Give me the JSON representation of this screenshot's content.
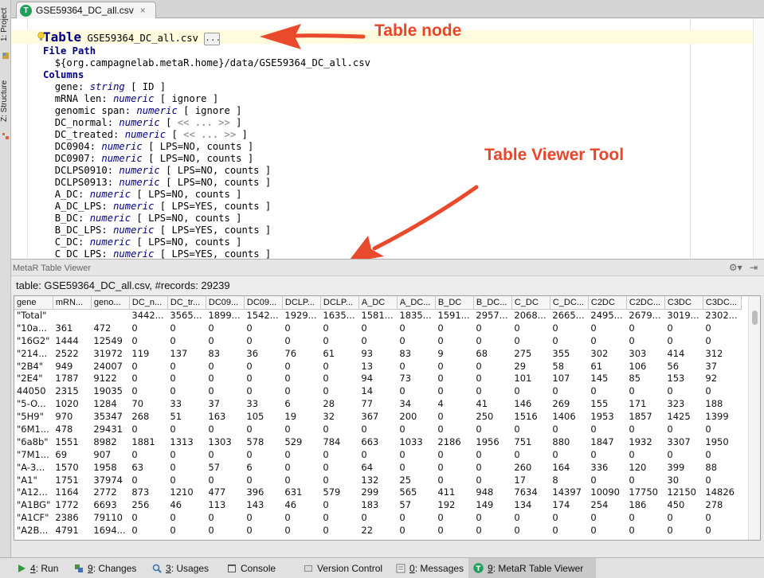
{
  "side_tabs": {
    "project": "1: Project",
    "structure": "Z: Structure"
  },
  "editor_tab": {
    "label": "GSE59364_DC_all.csv",
    "badge": "T",
    "close": "×"
  },
  "code": {
    "table_kw": "Table",
    "table_name": "GSE59364_DC_all.csv",
    "dots": "...",
    "file_path_kw": "File Path",
    "file_path": "${org.campagnelab.metaR.home}/data/GSE59364_DC_all.csv",
    "columns_kw": "Columns",
    "columns": [
      {
        "name": "gene:",
        "type": "string",
        "pre": " [ ",
        "meta": "ID",
        "post": " ]",
        "gray": false
      },
      {
        "name": "mRNA len:",
        "type": "numeric",
        "pre": " [ ",
        "meta": "ignore",
        "post": " ]",
        "gray": false
      },
      {
        "name": "genomic span:",
        "type": "numeric",
        "pre": " [ ",
        "meta": "ignore",
        "post": " ]",
        "gray": false
      },
      {
        "name": "DC_normal:",
        "type": "numeric",
        "pre": " [ ",
        "meta": "<< ... >>",
        "post": " ]",
        "gray": true
      },
      {
        "name": "DC_treated:",
        "type": "numeric",
        "pre": " [ ",
        "meta": "<< ... >>",
        "post": " ]",
        "gray": true
      },
      {
        "name": "DC0904:",
        "type": "numeric",
        "pre": " [ ",
        "meta": "LPS=NO, counts",
        "post": " ]",
        "gray": false
      },
      {
        "name": "DC0907:",
        "type": "numeric",
        "pre": " [ ",
        "meta": "LPS=NO, counts",
        "post": " ]",
        "gray": false
      },
      {
        "name": "DCLPS0910:",
        "type": "numeric",
        "pre": " [ ",
        "meta": "LPS=NO, counts",
        "post": " ]",
        "gray": false
      },
      {
        "name": "DCLPS0913:",
        "type": "numeric",
        "pre": " [ ",
        "meta": "LPS=NO, counts",
        "post": " ]",
        "gray": false
      },
      {
        "name": "A_DC:",
        "type": "numeric",
        "pre": " [ ",
        "meta": "LPS=NO, counts",
        "post": " ]",
        "gray": false
      },
      {
        "name": "A_DC_LPS:",
        "type": "numeric",
        "pre": " [ ",
        "meta": "LPS=YES, counts",
        "post": " ]",
        "gray": false
      },
      {
        "name": "B_DC:",
        "type": "numeric",
        "pre": " [ ",
        "meta": "LPS=NO, counts",
        "post": " ]",
        "gray": false
      },
      {
        "name": "B_DC_LPS:",
        "type": "numeric",
        "pre": " [ ",
        "meta": "LPS=YES, counts",
        "post": " ]",
        "gray": false
      },
      {
        "name": "C_DC:",
        "type": "numeric",
        "pre": " [ ",
        "meta": "LPS=NO, counts",
        "post": " ]",
        "gray": false
      },
      {
        "name": "C_DC_LPS:",
        "type": "numeric",
        "pre": " [ ",
        "meta": "LPS=YES, counts",
        "post": " ]",
        "gray": false
      }
    ]
  },
  "annotations": {
    "table_node": "Table node",
    "viewer_tool": "Table Viewer Tool",
    "color": "#e8452a"
  },
  "viewer": {
    "title": "MetaR Table Viewer",
    "info": "table: GSE59364_DC_all.csv, #records: 29239",
    "headers": [
      "gene",
      "mRN...",
      "geno...",
      "DC_n...",
      "DC_tr...",
      "DC09...",
      "DC09...",
      "DCLP...",
      "DCLP...",
      "A_DC",
      "A_DC...",
      "B_DC",
      "B_DC...",
      "C_DC",
      "C_DC...",
      "C2DC",
      "C2DC...",
      "C3DC",
      "C3DC..."
    ],
    "rows": [
      [
        "\"Total\"",
        "",
        "",
        "3442...",
        "3565...",
        "1899...",
        "1542...",
        "1929...",
        "1635...",
        "1581...",
        "1835...",
        "1591...",
        "2957...",
        "2068...",
        "2665...",
        "2495...",
        "2679...",
        "3019...",
        "2302..."
      ],
      [
        "\"10a...",
        "361",
        "472",
        "0",
        "0",
        "0",
        "0",
        "0",
        "0",
        "0",
        "0",
        "0",
        "0",
        "0",
        "0",
        "0",
        "0",
        "0",
        "0"
      ],
      [
        "\"16G2\"",
        "1444",
        "12549",
        "0",
        "0",
        "0",
        "0",
        "0",
        "0",
        "0",
        "0",
        "0",
        "0",
        "0",
        "0",
        "0",
        "0",
        "0",
        "0"
      ],
      [
        "\"214...",
        "2522",
        "31972",
        "119",
        "137",
        "83",
        "36",
        "76",
        "61",
        "93",
        "83",
        "9",
        "68",
        "275",
        "355",
        "302",
        "303",
        "414",
        "312"
      ],
      [
        "\"2B4\"",
        "949",
        "24007",
        "0",
        "0",
        "0",
        "0",
        "0",
        "0",
        "13",
        "0",
        "0",
        "0",
        "29",
        "58",
        "61",
        "106",
        "56",
        "37"
      ],
      [
        "\"2E4\"",
        "1787",
        "9122",
        "0",
        "0",
        "0",
        "0",
        "0",
        "0",
        "94",
        "73",
        "0",
        "0",
        "101",
        "107",
        "145",
        "85",
        "153",
        "92"
      ],
      [
        "44050",
        "2315",
        "19035",
        "0",
        "0",
        "0",
        "0",
        "0",
        "0",
        "14",
        "0",
        "0",
        "0",
        "0",
        "0",
        "0",
        "0",
        "0",
        "0"
      ],
      [
        "\"5-O...",
        "1020",
        "1284",
        "70",
        "33",
        "37",
        "33",
        "6",
        "28",
        "77",
        "34",
        "4",
        "41",
        "146",
        "269",
        "155",
        "171",
        "323",
        "188"
      ],
      [
        "\"5H9\"",
        "970",
        "35347",
        "268",
        "51",
        "163",
        "105",
        "19",
        "32",
        "367",
        "200",
        "0",
        "250",
        "1516",
        "1406",
        "1953",
        "1857",
        "1425",
        "1399"
      ],
      [
        "\"6M1...",
        "478",
        "29431",
        "0",
        "0",
        "0",
        "0",
        "0",
        "0",
        "0",
        "0",
        "0",
        "0",
        "0",
        "0",
        "0",
        "0",
        "0",
        "0"
      ],
      [
        "\"6a8b\"",
        "1551",
        "8982",
        "1881",
        "1313",
        "1303",
        "578",
        "529",
        "784",
        "663",
        "1033",
        "2186",
        "1956",
        "751",
        "880",
        "1847",
        "1932",
        "3307",
        "1950"
      ],
      [
        "\"7M1...",
        "69",
        "907",
        "0",
        "0",
        "0",
        "0",
        "0",
        "0",
        "0",
        "0",
        "0",
        "0",
        "0",
        "0",
        "0",
        "0",
        "0",
        "0"
      ],
      [
        "\"A-3...",
        "1570",
        "1958",
        "63",
        "0",
        "57",
        "6",
        "0",
        "0",
        "64",
        "0",
        "0",
        "0",
        "260",
        "164",
        "336",
        "120",
        "399",
        "88"
      ],
      [
        "\"A1\"",
        "1751",
        "37974",
        "0",
        "0",
        "0",
        "0",
        "0",
        "0",
        "132",
        "25",
        "0",
        "0",
        "17",
        "8",
        "0",
        "0",
        "30",
        "0"
      ],
      [
        "\"A12...",
        "1164",
        "2772",
        "873",
        "1210",
        "477",
        "396",
        "631",
        "579",
        "299",
        "565",
        "411",
        "948",
        "7634",
        "14397",
        "10090",
        "17750",
        "12150",
        "14826"
      ],
      [
        "\"A1BG\"",
        "1772",
        "6693",
        "256",
        "46",
        "113",
        "143",
        "46",
        "0",
        "183",
        "57",
        "192",
        "149",
        "134",
        "174",
        "254",
        "186",
        "450",
        "278"
      ],
      [
        "\"A1CF\"",
        "2386",
        "79110",
        "0",
        "0",
        "0",
        "0",
        "0",
        "0",
        "0",
        "0",
        "0",
        "0",
        "0",
        "0",
        "0",
        "0",
        "0",
        "0"
      ],
      [
        "\"A2B...",
        "4791",
        "1694...",
        "0",
        "0",
        "0",
        "0",
        "0",
        "0",
        "22",
        "0",
        "0",
        "0",
        "0",
        "0",
        "0",
        "0",
        "0",
        "0"
      ]
    ]
  },
  "bottom_tabs": [
    {
      "key": "4",
      "label": ": Run",
      "icon": "run-icon",
      "active": false
    },
    {
      "key": "9",
      "label": ": Changes",
      "icon": "changes-icon",
      "active": false
    },
    {
      "key": "3",
      "label": ": Usages",
      "icon": "usages-icon",
      "active": false
    },
    {
      "key": "",
      "label": "Console",
      "icon": "console-icon",
      "active": false
    },
    {
      "key": "",
      "label": "Version Control",
      "icon": "version-control-icon",
      "active": false
    },
    {
      "key": "0",
      "label": ": Messages",
      "icon": "messages-icon",
      "active": false
    },
    {
      "key": "9",
      "label": ": MetaR Table Viewer",
      "icon": "metar-icon",
      "active": true
    }
  ]
}
